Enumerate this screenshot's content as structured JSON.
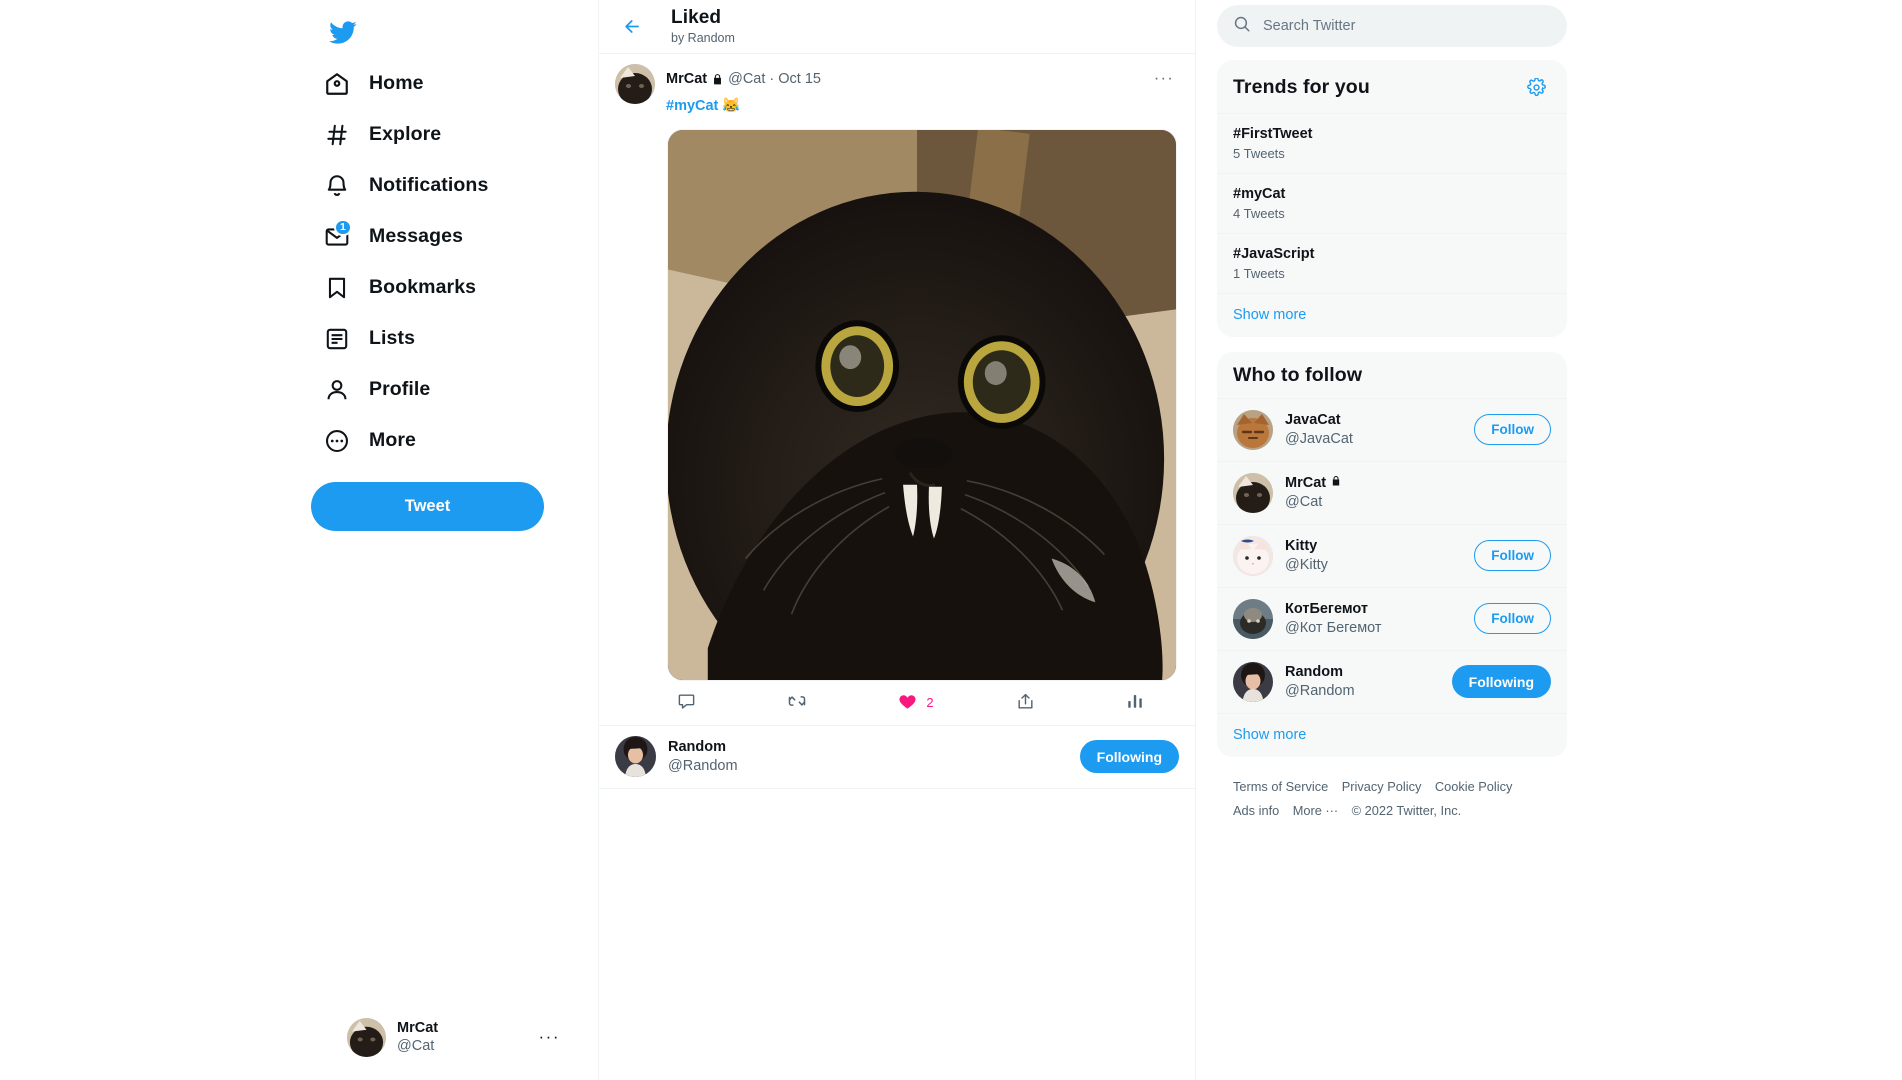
{
  "sidebar": {
    "logo": "twitter-bird",
    "items": [
      {
        "icon": "home-icon",
        "label": "Home"
      },
      {
        "icon": "hash-icon",
        "label": "Explore"
      },
      {
        "icon": "bell-icon",
        "label": "Notifications"
      },
      {
        "icon": "envelope-icon",
        "label": "Messages",
        "badge": "1"
      },
      {
        "icon": "bookmark-icon",
        "label": "Bookmarks"
      },
      {
        "icon": "list-icon",
        "label": "Lists"
      },
      {
        "icon": "person-icon",
        "label": "Profile"
      },
      {
        "icon": "more-circle-icon",
        "label": "More"
      }
    ],
    "tweet_button": "Tweet",
    "account": {
      "name": "MrCat",
      "handle": "@Cat",
      "menu": "···"
    }
  },
  "center": {
    "header": {
      "back": "←",
      "title": "Liked",
      "subtitle": "by Random"
    },
    "tweet": {
      "author": "MrCat",
      "protected": true,
      "handle": "@Cat",
      "separator": "·",
      "date": "Oct 15",
      "menu": "···",
      "text_hashtag": "#myCat",
      "text_emoji": "😹",
      "actions": {
        "reply": {
          "icon": "reply-icon",
          "count": ""
        },
        "retweet": {
          "icon": "retweet-icon",
          "count": ""
        },
        "like": {
          "icon": "heart-filled-icon",
          "count": "2"
        },
        "share": {
          "icon": "share-icon",
          "count": ""
        },
        "analytics": {
          "icon": "analytics-icon",
          "count": ""
        }
      }
    },
    "liked_by": {
      "name": "Random",
      "handle": "@Random",
      "button": "Following"
    }
  },
  "right": {
    "search": {
      "icon": "search-icon",
      "placeholder": "Search Twitter",
      "value": ""
    },
    "trends": {
      "title": "Trends for you",
      "settings_icon": "gear-icon",
      "items": [
        {
          "name": "#FirstTweet",
          "count": "5 Tweets"
        },
        {
          "name": "#myCat",
          "count": "4 Tweets"
        },
        {
          "name": "#JavaScript",
          "count": "1 Tweets"
        }
      ],
      "show_more": "Show more"
    },
    "who_to_follow": {
      "title": "Who to follow",
      "items": [
        {
          "name": "JavaCat",
          "protected": false,
          "handle": "@JavaCat",
          "button": "Follow",
          "state": "follow"
        },
        {
          "name": "MrCat",
          "protected": true,
          "handle": "@Cat",
          "button": "",
          "state": "none"
        },
        {
          "name": "Kitty",
          "protected": false,
          "handle": "@Kitty",
          "button": "Follow",
          "state": "follow"
        },
        {
          "name": "КотБегемот",
          "protected": false,
          "handle": "@Кот Бегемот",
          "button": "Follow",
          "state": "follow"
        },
        {
          "name": "Random",
          "protected": false,
          "handle": "@Random",
          "button": "Following",
          "state": "following"
        }
      ],
      "show_more": "Show more"
    },
    "footer": {
      "links_row1": [
        "Terms of Service",
        "Privacy Policy",
        "Cookie Policy"
      ],
      "links_row2": [
        "Ads info",
        "More ···"
      ],
      "copyright": "© 2022 Twitter, Inc."
    }
  },
  "colors": {
    "accent": "#1d9bf0",
    "like": "#f91880",
    "text": "#0f1419",
    "muted": "#536471",
    "panel": "#f7f9f9"
  }
}
